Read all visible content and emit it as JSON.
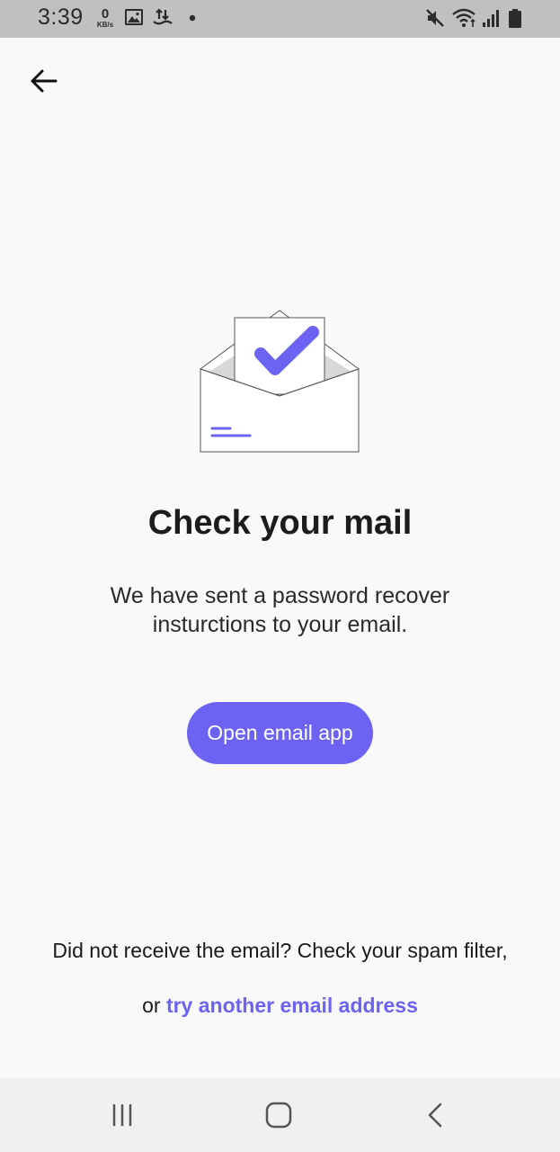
{
  "status_bar": {
    "time": "3:39",
    "net_speed_value": "0",
    "net_speed_unit": "KB/s",
    "icons": [
      "gallery-icon",
      "data-transfer-icon",
      "notification-dot-icon",
      "mute-icon",
      "wifi-icon",
      "signal-icon",
      "battery-icon"
    ]
  },
  "header": {
    "back_icon": "arrow-left-icon"
  },
  "main": {
    "illustration": "email-check-icon",
    "title": "Check your mail",
    "subtitle": "We have sent a password recover insturctions to your email.",
    "open_button_label": "Open email app"
  },
  "footer": {
    "line1": "Did not receive the email? Check your spam filter,",
    "line2_prefix": "or ",
    "link_label": "try another email address"
  },
  "nav_bar": {
    "icons": [
      "recent-apps-icon",
      "home-icon",
      "back-icon"
    ]
  },
  "colors": {
    "accent": "#6c63f2",
    "background": "#f9f9f9",
    "status_bar": "#c0c0c0",
    "nav_bar": "#f0f0f0"
  }
}
